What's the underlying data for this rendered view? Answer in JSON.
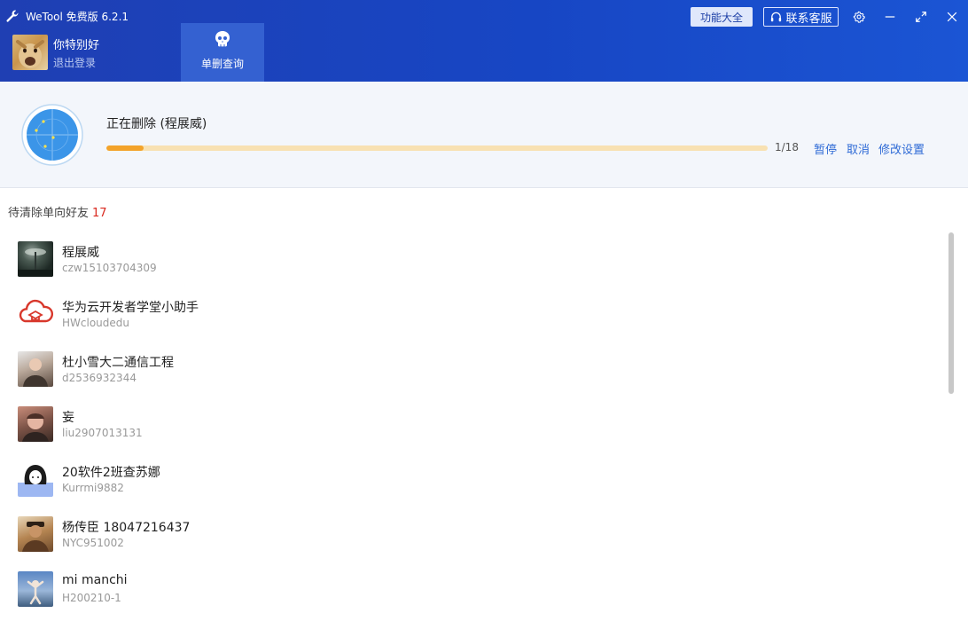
{
  "app": {
    "title": "WeTool 免费版 6.2.1"
  },
  "header": {
    "features_label": "功能大全",
    "service_label": "联系客服",
    "user": {
      "name": "你特别好",
      "logout_label": "退出登录"
    },
    "nav_tab": {
      "label": "单删查询",
      "icon": "skull-icon"
    }
  },
  "progress": {
    "status": "正在删除 (程展威)",
    "count_text": "1/18",
    "value": 0.056,
    "actions": {
      "pause": "暂停",
      "cancel": "取消",
      "settings": "修改设置"
    }
  },
  "list": {
    "title": "待清除单向好友",
    "count": "17",
    "items": [
      {
        "name": "程展威",
        "wxid": "czw15103704309"
      },
      {
        "name": "华为云开发者学堂小助手",
        "wxid": "HWcloudedu"
      },
      {
        "name": "杜小雪大二通信工程",
        "wxid": "d2536932344"
      },
      {
        "name": "妄",
        "wxid": "liu2907013131"
      },
      {
        "name": "20软件2班查苏娜",
        "wxid": "Kurrmi9882"
      },
      {
        "name": "杨传臣 18047216437",
        "wxid": "NYC951002"
      },
      {
        "name": "mi manchi",
        "wxid": "H200210-1"
      }
    ]
  },
  "colors": {
    "header": "#1f3fb3",
    "accent": "#2f6bd6",
    "progress": "#f3a32a",
    "count": "#d9281e"
  }
}
